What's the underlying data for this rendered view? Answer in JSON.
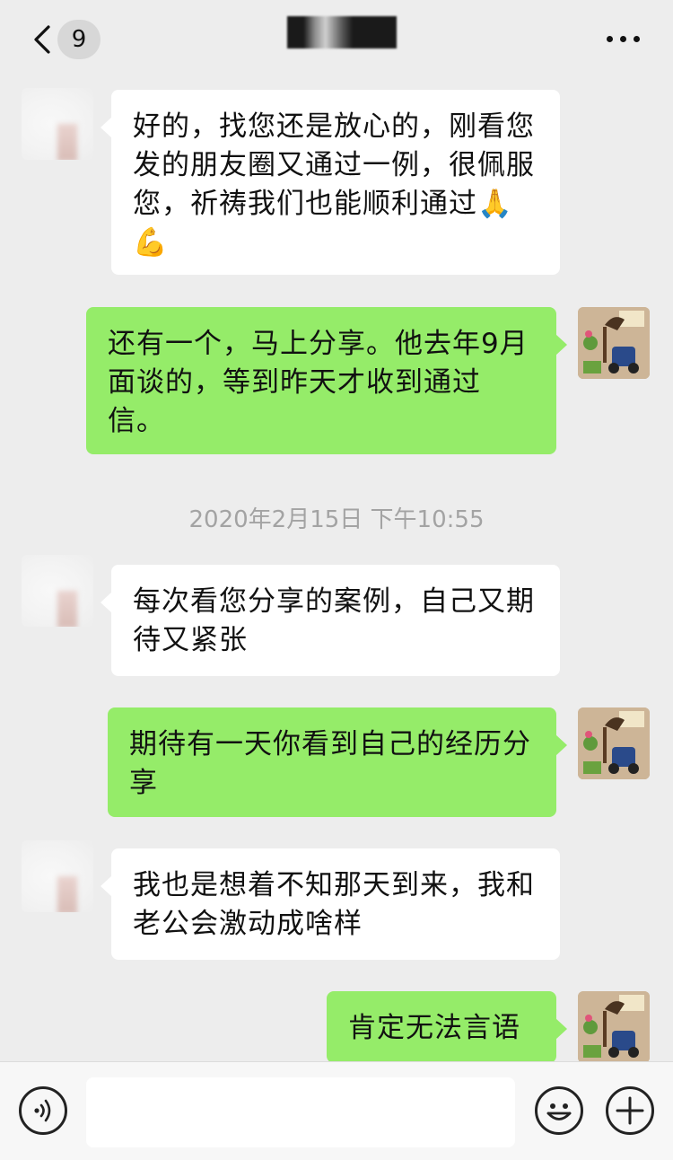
{
  "header": {
    "back_icon": "chevron-left-icon",
    "unread_count": "9",
    "more_icon": "more-dots-icon"
  },
  "messages": [
    {
      "side": "in",
      "text": "好的，找您还是放心的，刚看您发的朋友圈又通过一例，很佩服您，祈祷我们也能顺利通过🙏💪"
    },
    {
      "side": "out",
      "text": "还有一个，马上分享。他去年9月面谈的，等到昨天才收到通过信。"
    },
    {
      "side": "in",
      "text": "每次看您分享的案例，自己又期待又紧张"
    },
    {
      "side": "out",
      "text": "期待有一天你看到自己的经历分享"
    },
    {
      "side": "in",
      "text": "我也是想着不知那天到来，我和老公会激动成啥样"
    },
    {
      "side": "out",
      "text": "肯定无法言语"
    }
  ],
  "timestamp": "2020年2月15日 下午10:55",
  "colors": {
    "background": "#ededed",
    "incoming_bubble": "#ffffff",
    "outgoing_bubble": "#95ec69",
    "timestamp_text": "#a3a3a3"
  },
  "input_bar": {
    "voice_icon": "voice-icon",
    "emoji_icon": "emoji-smile-icon",
    "add_icon": "plus-circle-icon"
  }
}
